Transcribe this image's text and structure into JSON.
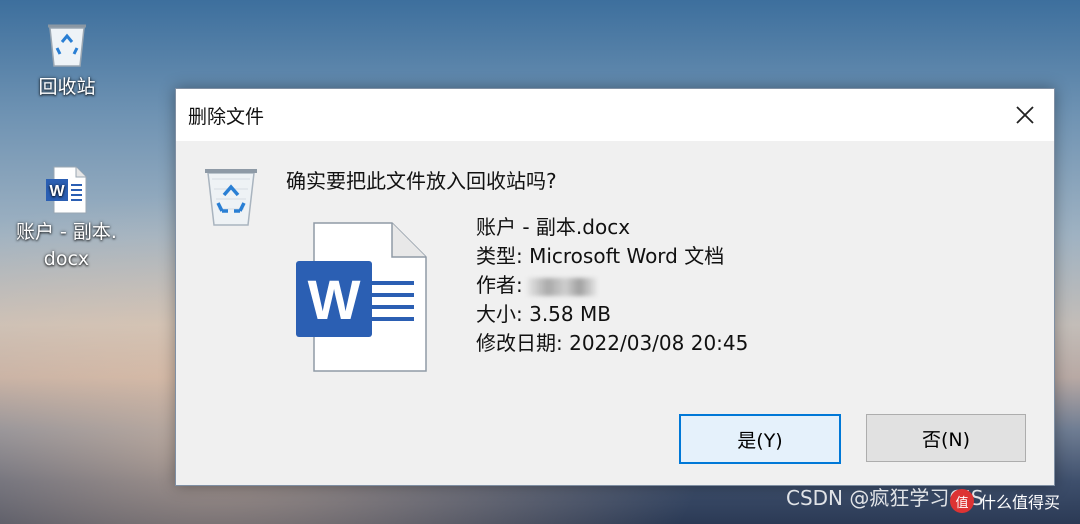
{
  "desktop": {
    "recycle_bin_label": "回收站",
    "file_label_line1": "账户 - 副本.",
    "file_label_line2": "docx"
  },
  "dialog": {
    "title": "删除文件",
    "question": "确实要把此文件放入回收站吗?",
    "file": {
      "name": "账户 - 副本.docx",
      "type": "类型: Microsoft Word 文档",
      "author_label": "作者:",
      "size": "大小: 3.58 MB",
      "modified": "修改日期: 2022/03/08 20:45"
    },
    "yes_button": "是(Y)",
    "no_button": "否(N)"
  },
  "watermark": {
    "text": "CSDN @疯狂学习GIS",
    "badge_text": "值",
    "site": "什么值得买"
  },
  "colors": {
    "accent": "#0078d7",
    "word_blue": "#2b5fb3"
  }
}
